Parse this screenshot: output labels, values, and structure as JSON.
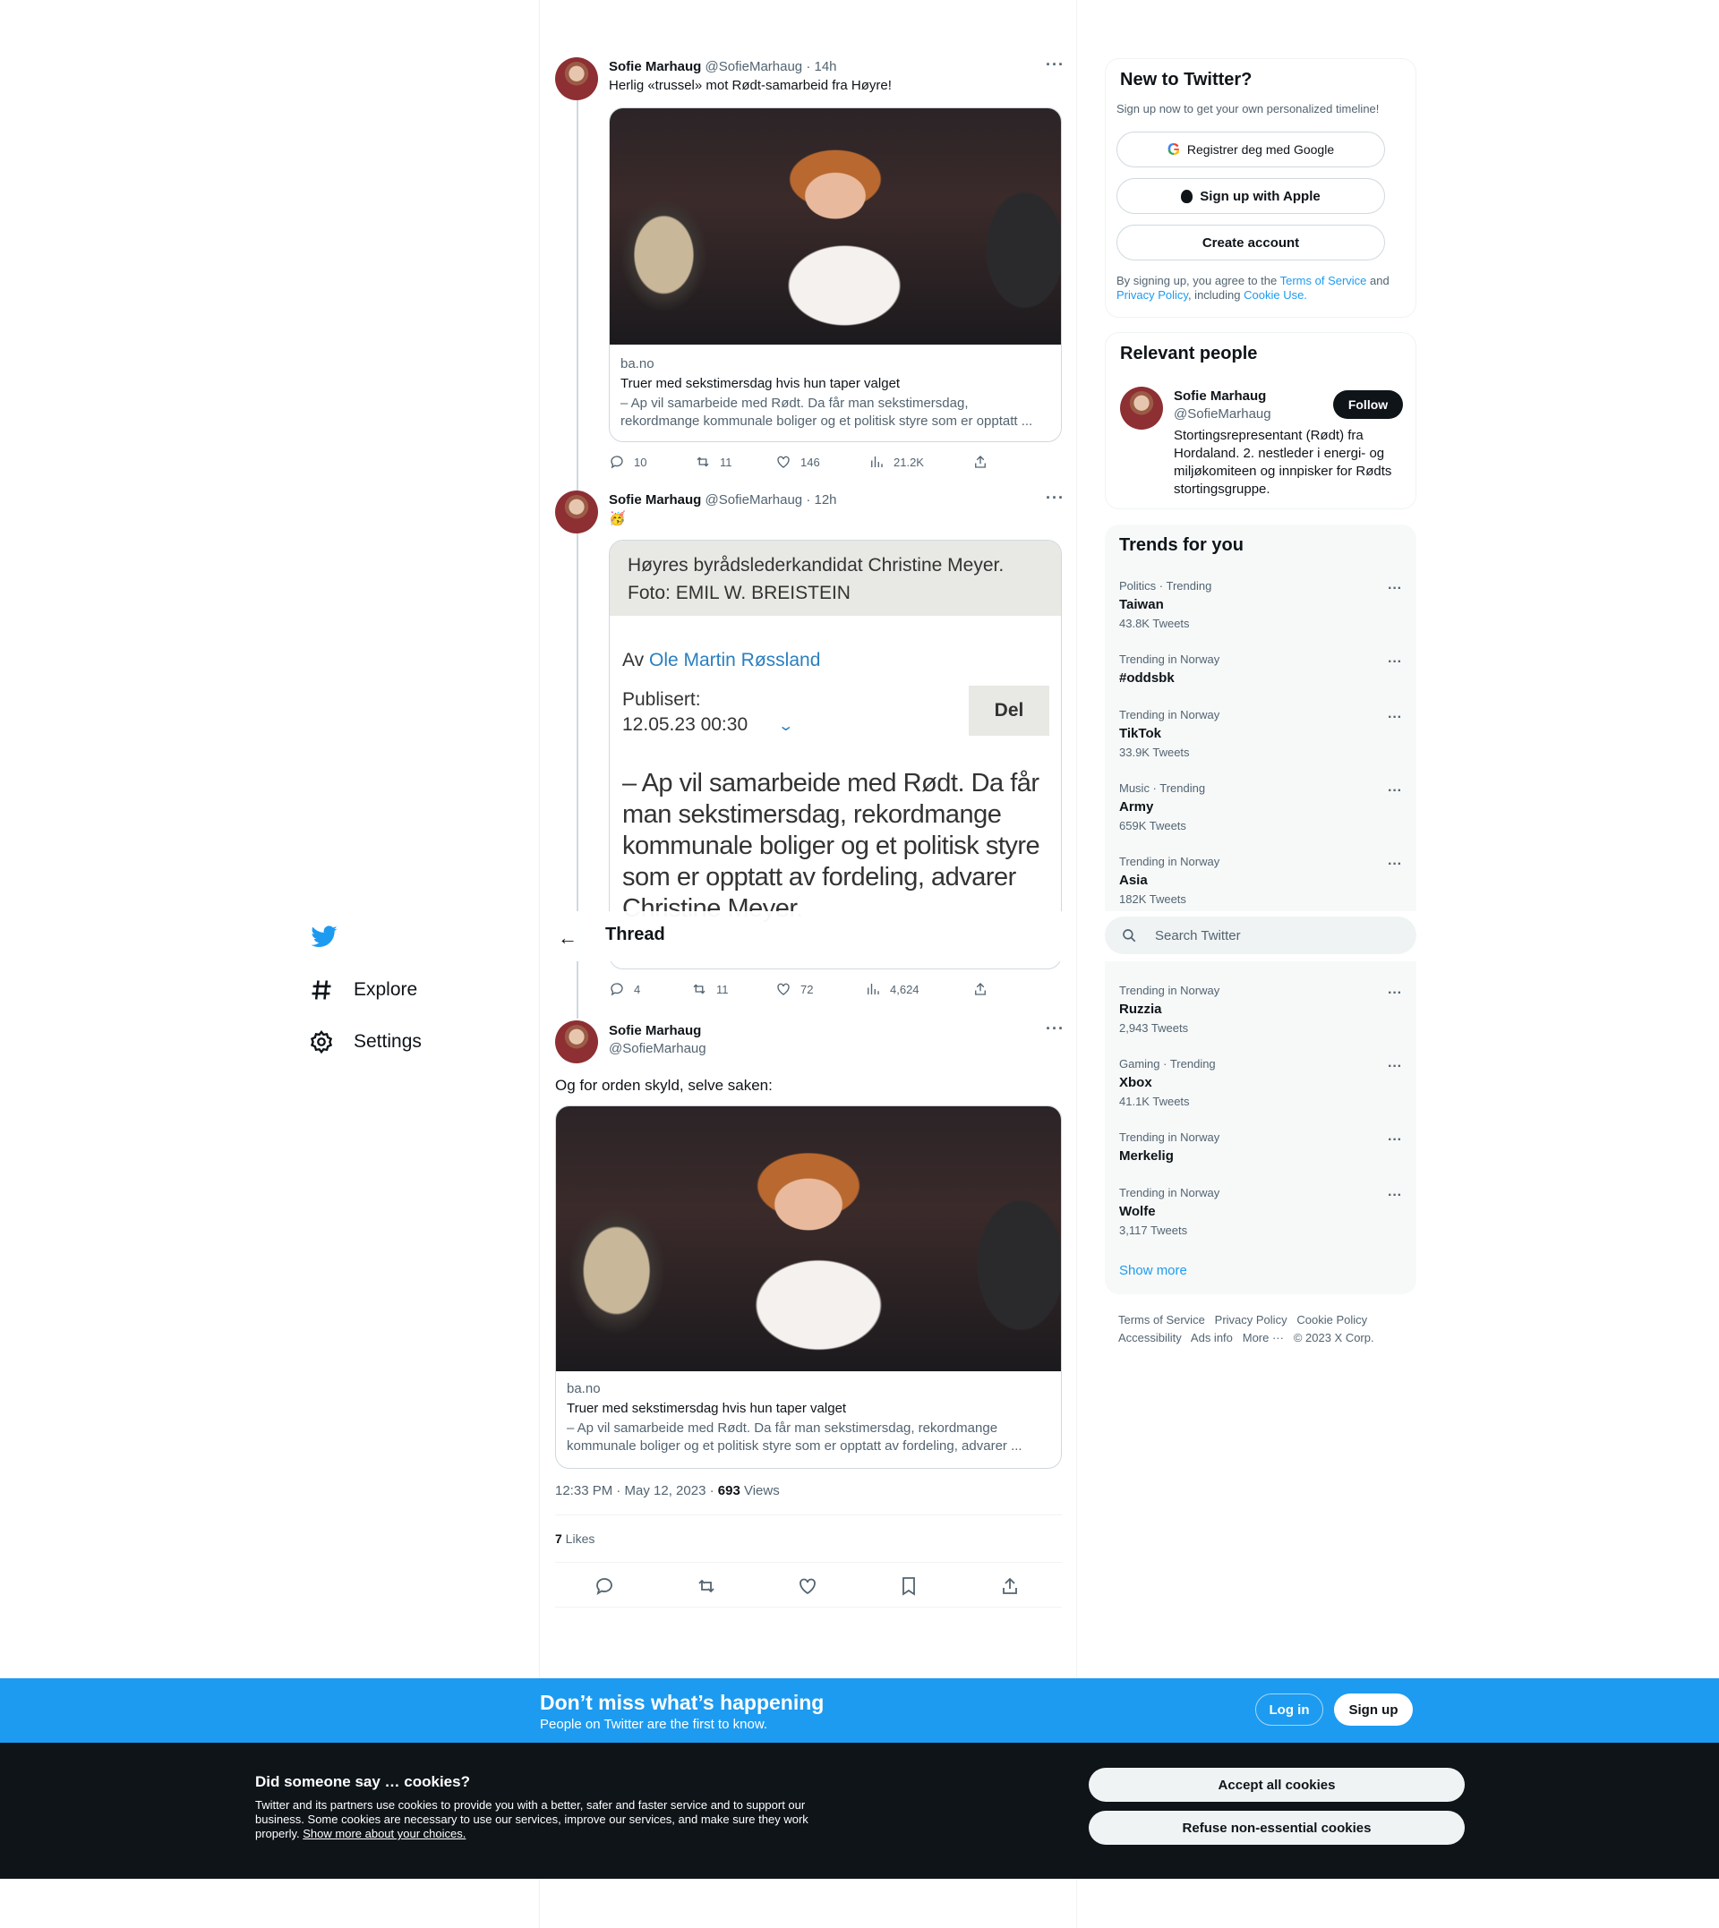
{
  "nav": {
    "explore": "Explore",
    "settings": "Settings"
  },
  "thread_header": {
    "title": "Thread"
  },
  "tweets": [
    {
      "author": "Sofie Marhaug",
      "handle": "@SofieMarhaug",
      "time": "· 14h",
      "text": "Herlig «trussel» mot Rødt-samarbeid fra Høyre!",
      "card": {
        "domain": "ba.no",
        "title": "Truer med sekstimersdag hvis hun taper valget",
        "desc": "– Ap vil samarbeide med Rødt. Da får man sekstimersdag, rekordmange kommunale boliger og et politisk styre som er opptatt ..."
      },
      "stats": {
        "replies": "10",
        "retweets": "11",
        "likes": "146",
        "views": "21.2K"
      }
    },
    {
      "author": "Sofie Marhaug",
      "handle": "@SofieMarhaug",
      "time": "· 12h",
      "text": "🥳",
      "article": {
        "caption": "Høyres byrådslederkandidat Christine Meyer. Foto: EMIL W. BREISTEIN",
        "by_prefix": "Av",
        "author": "Ole Martin Røssland",
        "published_label": "Publisert:",
        "published_date": "12.05.23 00:30",
        "share": "Del",
        "lead": "– Ap vil samarbeide med Rødt. Da får man sekstimersdag, rekordmange kommunale boliger og et politisk styre som er opptatt av fordeling, advarer Christine Meyer."
      },
      "stats": {
        "replies": "4",
        "retweets": "11",
        "likes": "72",
        "views": "4,624"
      }
    },
    {
      "author": "Sofie Marhaug",
      "handle": "@SofieMarhaug",
      "text": "Og for orden skyld, selve saken:",
      "card": {
        "domain": "ba.no",
        "title": "Truer med sekstimersdag hvis hun taper valget",
        "desc": "– Ap vil samarbeide med Rødt. Da får man sekstimersdag, rekordmange kommunale boliger og et politisk styre som er opptatt av fordeling, advarer ..."
      },
      "timestamp": "12:33 PM · May 12, 2023 · ",
      "views_count": "693",
      "views_label": " Views",
      "likes_count": "7",
      "likes_label": " Likes"
    }
  ],
  "new_to_twitter": {
    "title": "New to Twitter?",
    "subtitle": "Sign up now to get your own personalized timeline!",
    "google": "Registrer deg med Google",
    "apple": "Sign up with Apple",
    "create": "Create account",
    "terms_prefix": "By signing up, you agree to the ",
    "terms": "Terms of Service",
    "and": " and ",
    "privacy": "Privacy Policy",
    "including": ", including ",
    "cookie": "Cookie Use."
  },
  "relevant_people": {
    "title": "Relevant people",
    "name": "Sofie Marhaug",
    "handle": "@SofieMarhaug",
    "follow": "Follow",
    "bio": "Stortingsrepresentant (Rødt) fra Hordaland. 2. nestleder i energi- og miljøkomiteen og innpisker for Rødts stortingsgruppe."
  },
  "trends": {
    "title": "Trends for you",
    "items": [
      {
        "category": "Politics · Trending",
        "name": "Taiwan",
        "count": "43.8K Tweets"
      },
      {
        "category": "Trending in Norway",
        "name": "#oddsbk",
        "count": ""
      },
      {
        "category": "Trending in Norway",
        "name": "TikTok",
        "count": "33.9K Tweets"
      },
      {
        "category": "Music · Trending",
        "name": "Army",
        "count": "659K Tweets"
      },
      {
        "category": "Trending in Norway",
        "name": "Asia",
        "count": "182K Tweets"
      },
      {
        "category": "Trending in Norway",
        "name": "Ruzzia",
        "count": "2,943 Tweets"
      },
      {
        "category": "Gaming · Trending",
        "name": "Xbox",
        "count": "41.1K Tweets"
      },
      {
        "category": "Trending in Norway",
        "name": "Merkelig",
        "count": ""
      },
      {
        "category": "Trending in Norway",
        "name": "Wolfe",
        "count": "3,117 Tweets"
      }
    ],
    "show_more": "Show more"
  },
  "search": {
    "placeholder": "Search Twitter"
  },
  "footer": {
    "tos": "Terms of Service",
    "privacy": "Privacy Policy",
    "cookie": "Cookie Policy",
    "accessibility": "Accessibility",
    "ads": "Ads info",
    "more": "More ···",
    "copyright": "© 2023 X Corp."
  },
  "signup_banner": {
    "title": "Don’t miss what’s happening",
    "subtitle": "People on Twitter are the first to know.",
    "login": "Log in",
    "signup": "Sign up"
  },
  "cookie_banner": {
    "title": "Did someone say … cookies?",
    "text": "Twitter and its partners use cookies to provide you with a better, safer and faster service and to support our business. Some cookies are necessary to use our services, improve our services, and make sure they work properly.",
    "link": "Show more about your choices.",
    "accept": "Accept all cookies",
    "refuse": "Refuse non-essential cookies"
  },
  "colors": {
    "accent": "#1d9bf0",
    "text": "#0f1419",
    "muted": "#536471",
    "dark": "#0f1419"
  }
}
